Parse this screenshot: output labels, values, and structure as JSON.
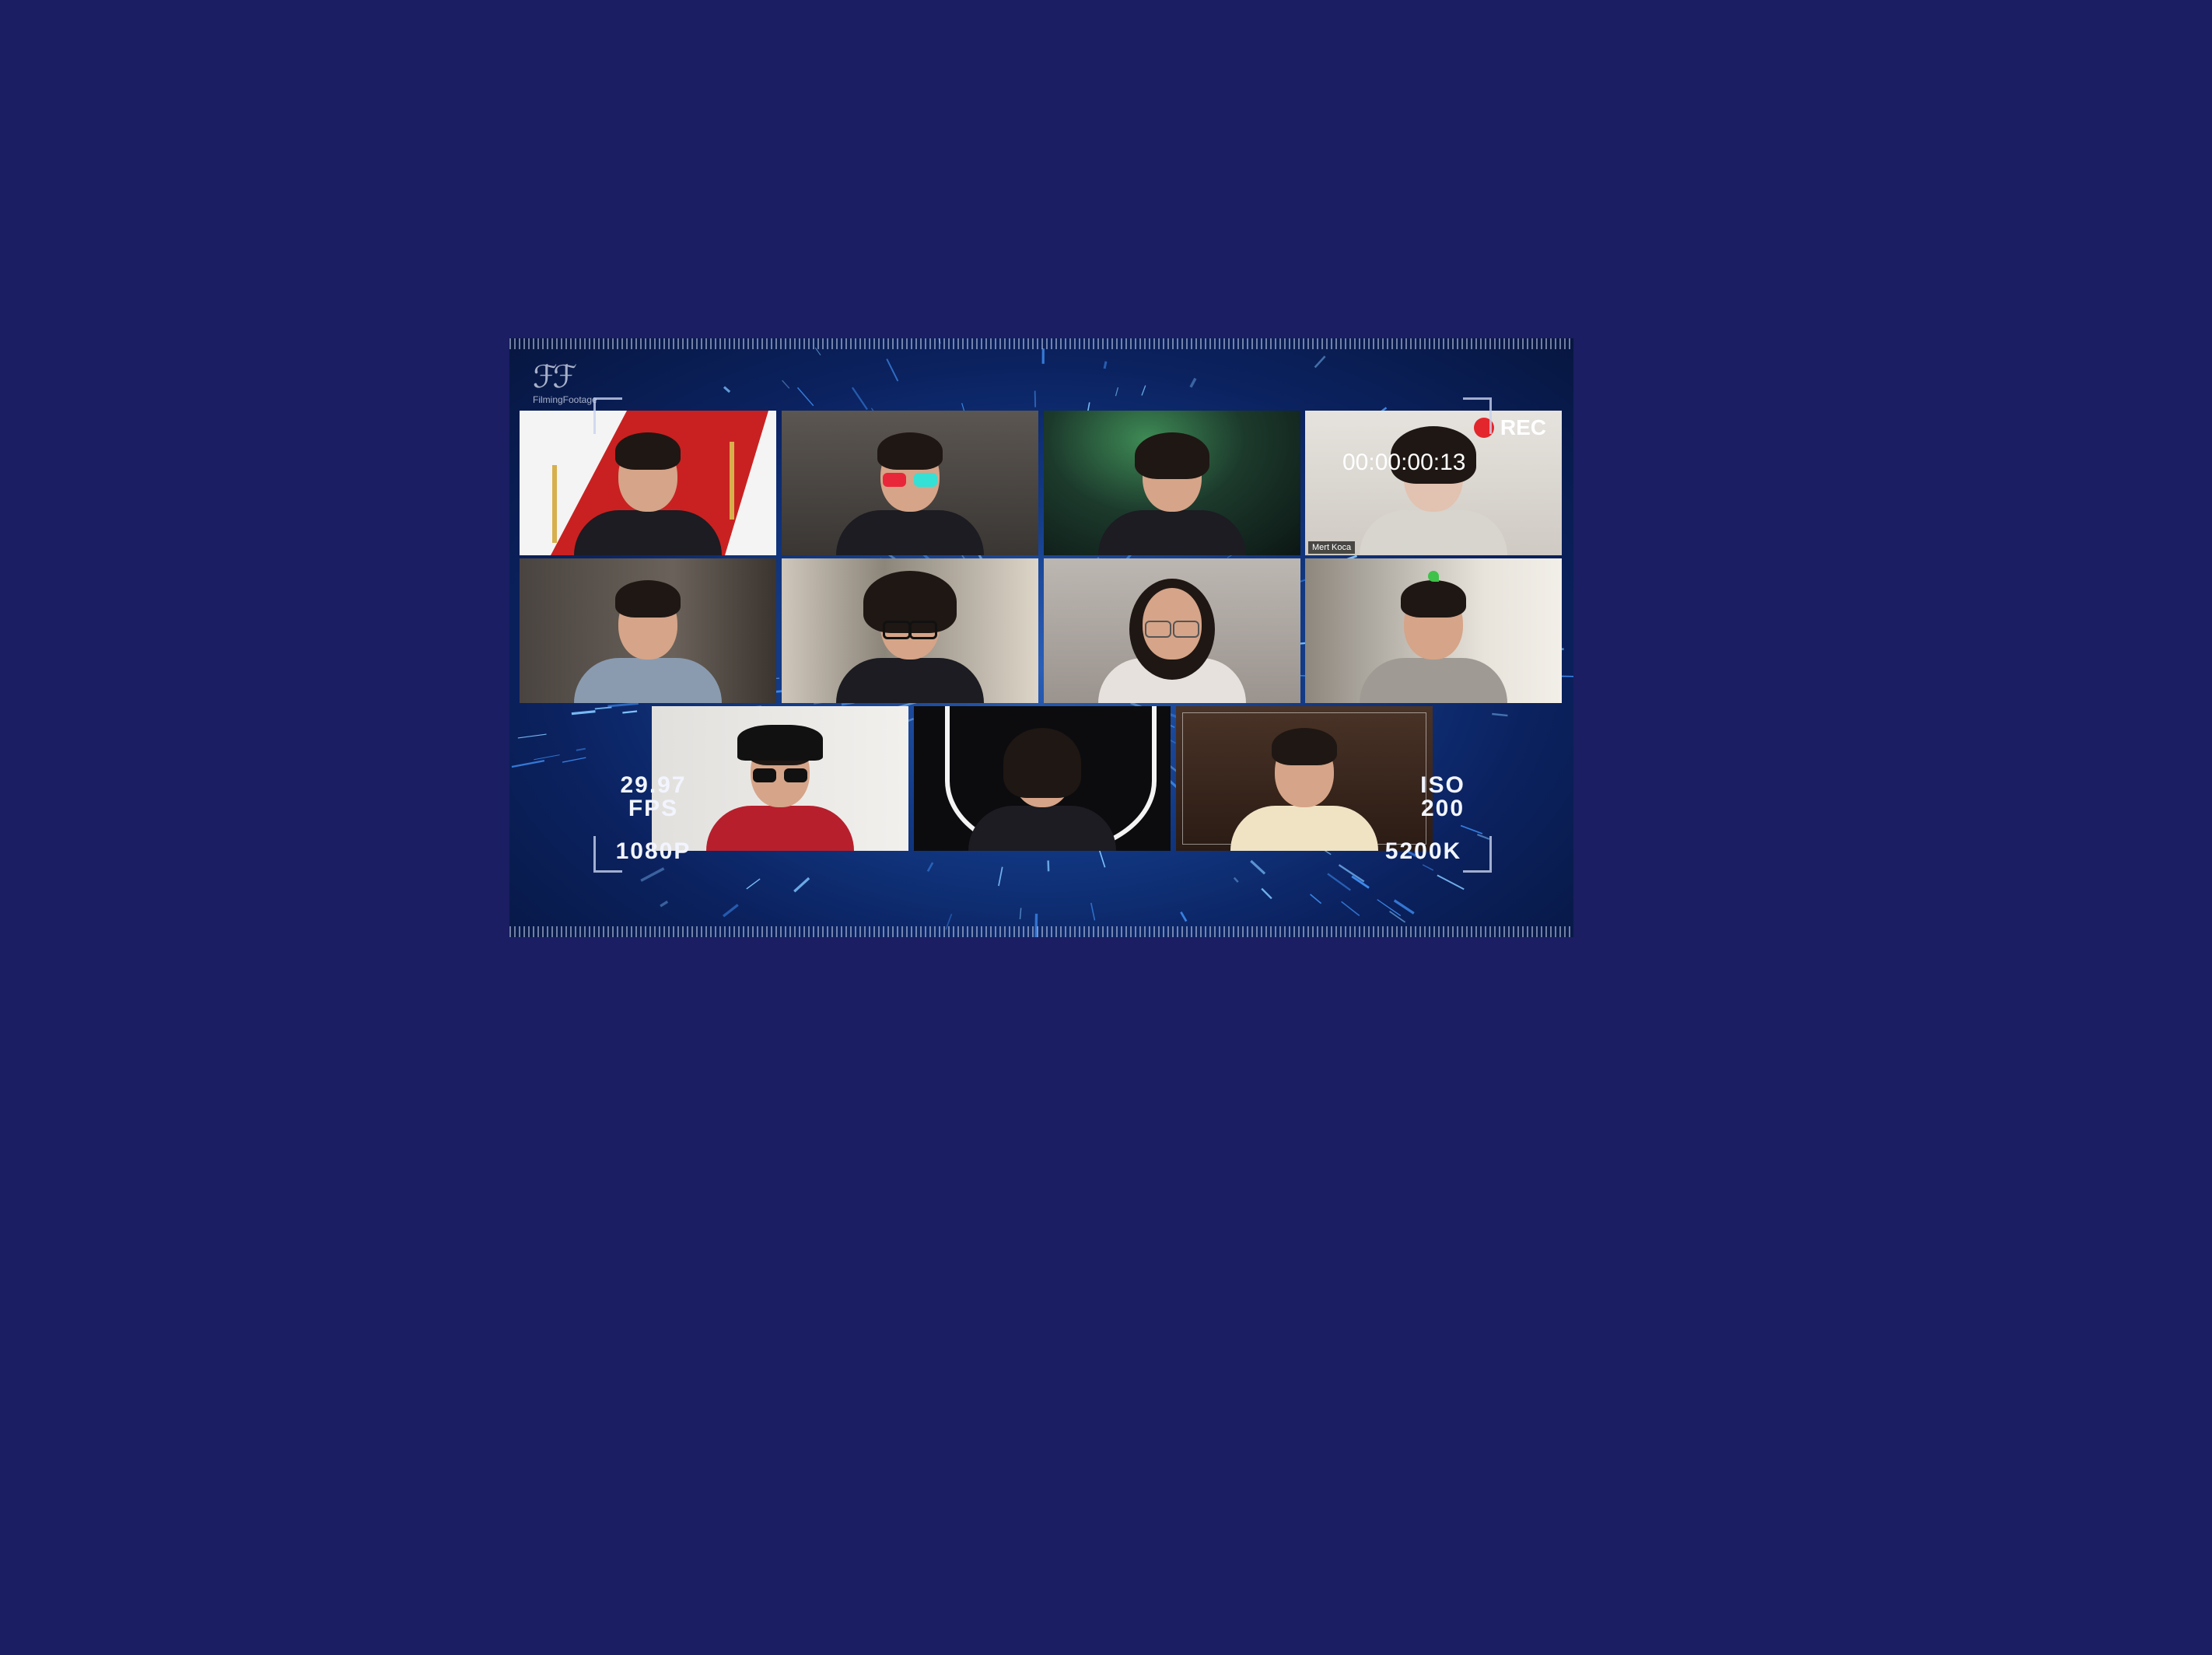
{
  "call": {
    "logo_text": "FilmingFootage",
    "rec_label": "REC",
    "rec_timer": "00:00:00:13",
    "highlighted_name": "Mert Koca",
    "overlay": {
      "fps_value": "29.97",
      "fps_label": "FPS",
      "resolution": "1080P",
      "iso_label": "ISO",
      "iso_value": "200",
      "white_balance": "5200K"
    }
  },
  "colors": {
    "page_bg": "#1b1e63",
    "active_speaker_border": "#d9e4a0",
    "rec_dot": "#e3262b"
  }
}
